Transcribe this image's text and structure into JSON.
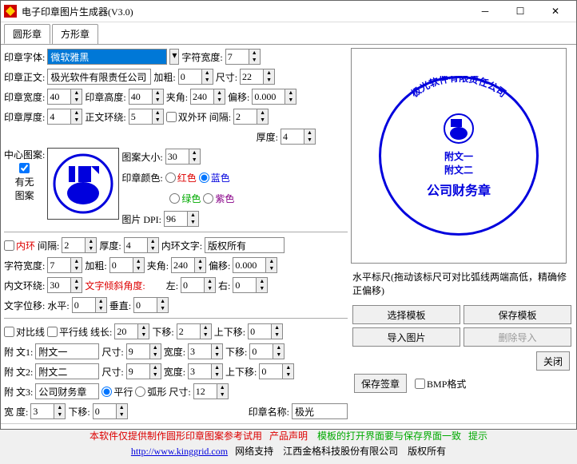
{
  "title": "电子印章图片生成器(V3.0)",
  "tabs": {
    "round": "圆形章",
    "square": "方形章"
  },
  "font": {
    "label": "印章字体:",
    "value": "微软雅黑",
    "width_label": "字符宽度:",
    "width_val": "7"
  },
  "main_text": {
    "label": "印章正文:",
    "value": "极光软件有限责任公司",
    "bold_label": "加粗:",
    "bold_val": "0",
    "size_label": "尺寸:",
    "size_val": "22"
  },
  "seal_dim": {
    "w_label": "印章宽度:",
    "w_val": "40",
    "h_label": "印章高度:",
    "h_val": "40",
    "angle_label": "夹角:",
    "angle_val": "240",
    "offset_label": "偏移:",
    "offset_val": "0.000"
  },
  "thickness": {
    "label": "印章厚度:",
    "val": "4",
    "ring_label": "正文环绕:",
    "ring_val": "5",
    "double_ring": "双外环",
    "gap_label": "间隔:",
    "gap_val": "2"
  },
  "height_row": {
    "label": "厚度:",
    "val": "4"
  },
  "pattern": {
    "label": "中心图案:",
    "has_label": "有无\n图案",
    "size_label": "图案大小:",
    "size_val": "30",
    "color_label": "印章颜色:",
    "red": "红色",
    "blue": "蓝色",
    "green": "绿色",
    "purple": "紫色",
    "dpi_label": "图片 DPI:",
    "dpi_val": "96"
  },
  "inner": {
    "ring_label": "内环",
    "gap_label": "间隔:",
    "gap_val": "2",
    "thick_label": "厚度:",
    "thick_val": "4",
    "text_label": "内环文字:",
    "text_val": "版权所有"
  },
  "inner2": {
    "width_label": "字符宽度:",
    "width_val": "7",
    "bold_label": "加粗:",
    "bold_val": "0",
    "angle_label": "夹角:",
    "angle_val": "240",
    "offset_label": "偏移:",
    "offset_val": "0.000"
  },
  "inner3": {
    "ring_label": "内文环绕:",
    "ring_val": "30",
    "tilt_label": "文字倾斜角度:",
    "left_label": "左:",
    "left_val": "0",
    "right_label": "右:",
    "right_val": "0"
  },
  "textpos": {
    "label": "文字位移:",
    "h_label": "水平:",
    "h_val": "0",
    "v_label": "垂直:",
    "v_val": "0"
  },
  "compare": {
    "cmp_label": "对比线",
    "par_label": "平行线",
    "len_label": "线长:",
    "len_val": "20",
    "down_label": "下移:",
    "down_val": "2",
    "updown_label": "上下移:",
    "updown_val": "0"
  },
  "attach1": {
    "label": "附 文1:",
    "val": "附文一",
    "size_label": "尺寸:",
    "size_val": "9",
    "width_label": "宽度:",
    "width_val": "3",
    "down_label": "下移:",
    "down_val": "0"
  },
  "attach2": {
    "label": "附 文2:",
    "val": "附文二",
    "size_label": "尺寸:",
    "size_val": "9",
    "width_label": "宽度:",
    "width_val": "3",
    "up_label": "上下移:",
    "up_val": "0"
  },
  "attach3": {
    "label": "附 文3:",
    "val": "公司财务章",
    "par_label": "平行",
    "arc_label": "弧形",
    "size_label": "尺寸:",
    "size_val": "12"
  },
  "widthrow": {
    "label": "宽   度:",
    "val": "3",
    "down_label": "下移:",
    "down_val": "0",
    "name_label": "印章名称:",
    "name_val": "极光"
  },
  "ruler": "水平标尺(拖动该标尺可对比弧线两端高低，精确修正偏移)",
  "buttons": {
    "select_tpl": "选择模板",
    "save_tpl": "保存模板",
    "import_img": "导入图片",
    "del_import": "删除导入",
    "save_sig": "保存签章",
    "close": "关闭",
    "bmp": "BMP格式"
  },
  "seal_preview": {
    "company": "极光软件有限责任公司",
    "a1": "附文一",
    "a2": "附文二",
    "a3": "公司财务章"
  },
  "footer": {
    "line1a": "本软件仅提供制作圆形印章图案参考试用",
    "line1b": "产品声明",
    "line1c": "模板的打开界面要与保存界面一致",
    "line1d": "提示",
    "url": "http://www.kinggrid.com",
    "net": "网络支持",
    "company": "江西金格科技股份有限公司",
    "copy": "版权所有"
  }
}
